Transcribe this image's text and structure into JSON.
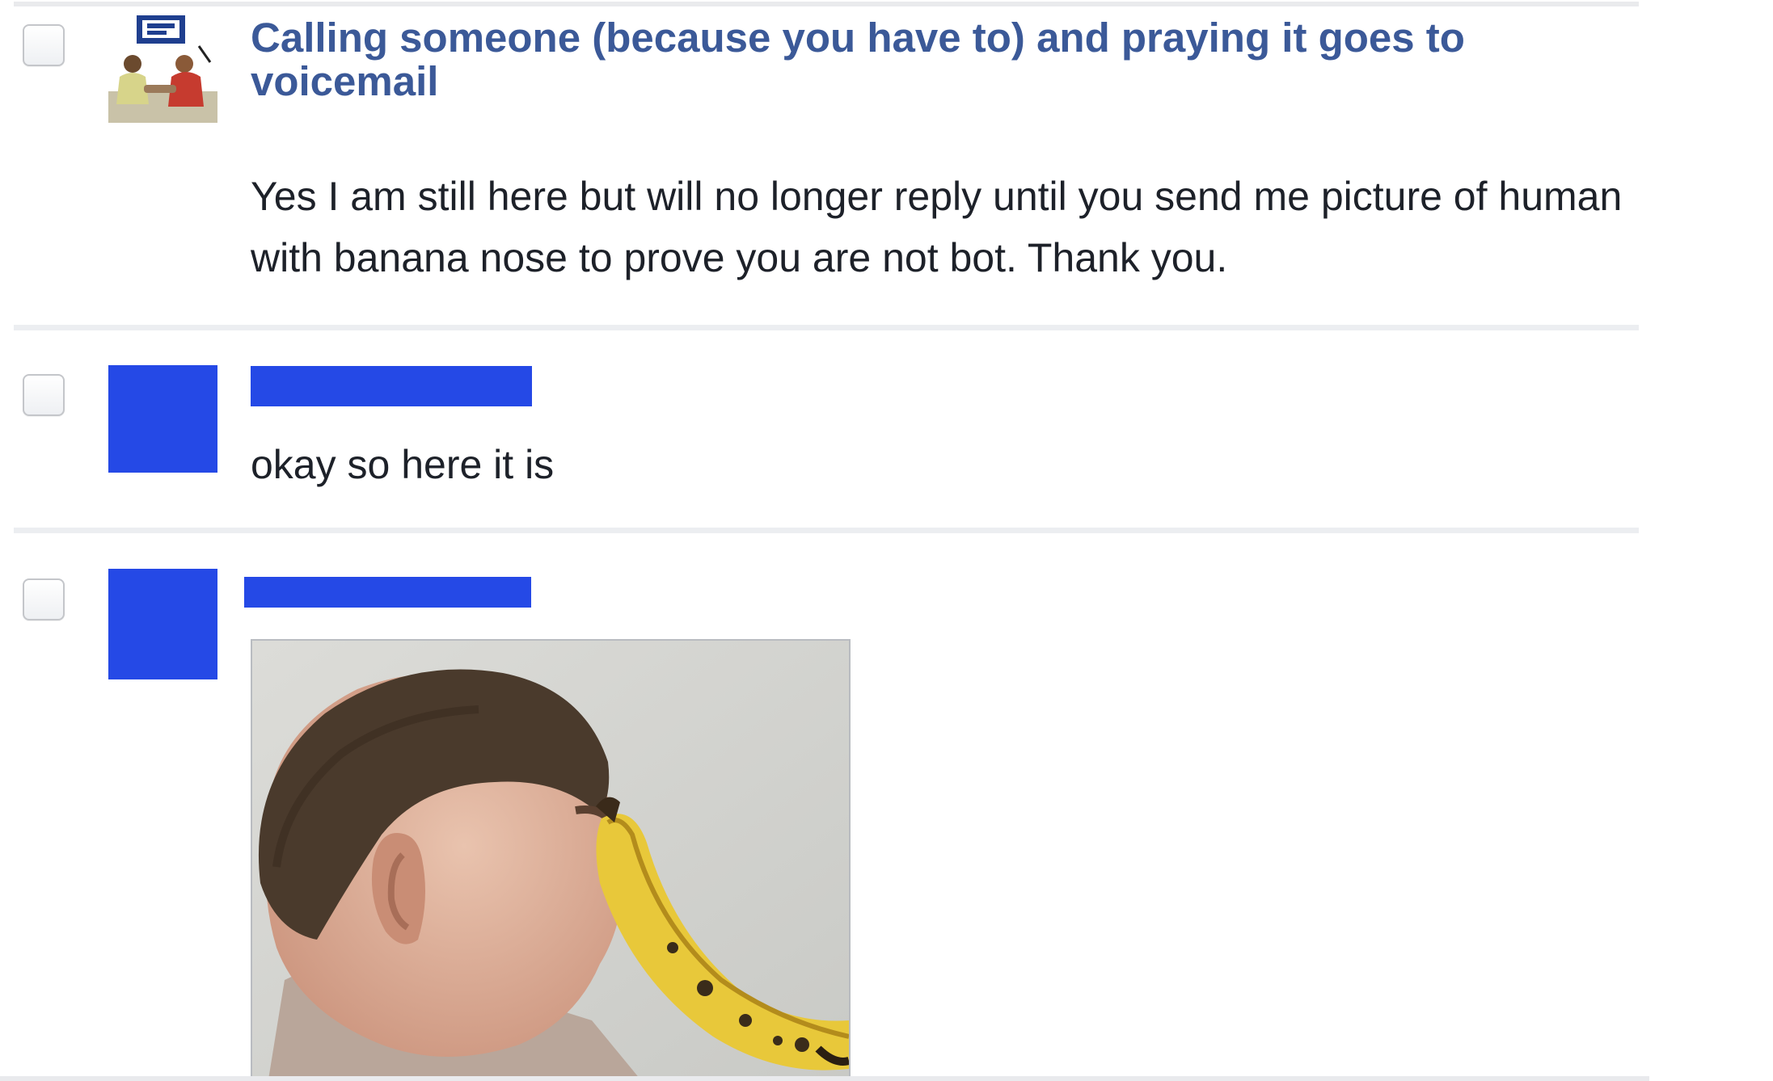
{
  "thread": {
    "subject": "Calling someone (because you have to) and praying it goes to voicemail"
  },
  "messages": [
    {
      "sender": "",
      "text": "Yes I am still here but will no longer reply until you send me picture of human with banana nose to prove you are not bot. Thank you."
    },
    {
      "sender": "",
      "text": "okay so here it is"
    },
    {
      "sender": "",
      "attachment": {
        "icon": "photo-man-with-banana-nose"
      }
    }
  ],
  "colors": {
    "link_blue": "#3b5998",
    "redaction_blue": "#2549e6",
    "text": "#1d2129"
  }
}
